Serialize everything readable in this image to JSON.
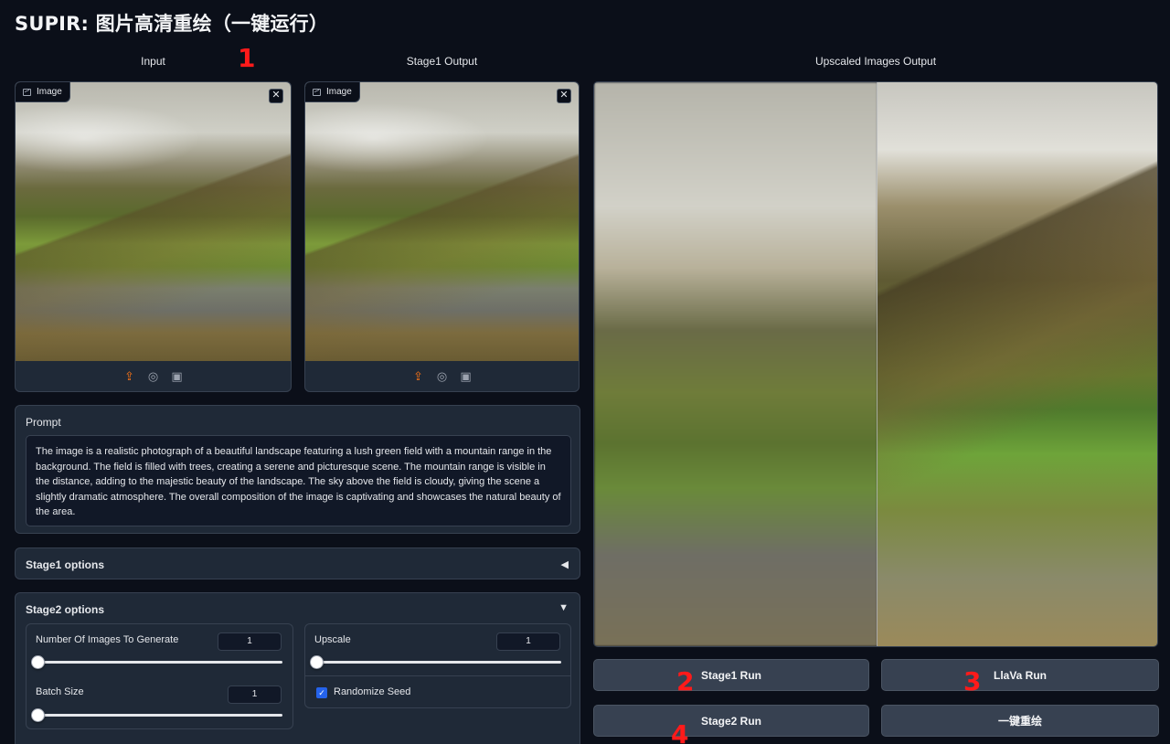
{
  "app": {
    "title": "SUPIR: 图片高清重绘（一键运行）"
  },
  "columns": {
    "input_label": "Input",
    "stage1_label": "Stage1 Output",
    "upscaled_label": "Upscaled Images Output"
  },
  "markers": [
    "1",
    "2",
    "3",
    "4"
  ],
  "image_panels": {
    "badge": "Image",
    "close": "✕",
    "tools": [
      "upload-icon",
      "webcam-icon",
      "clipboard-icon"
    ]
  },
  "prompt": {
    "label": "Prompt",
    "value": "The image is a realistic photograph of a beautiful landscape featuring a lush green field with a mountain range in the background. The field is filled with trees, creating a serene and picturesque scene. The mountain range is visible in the distance, adding to the majestic beauty of the landscape. The sky above the field is cloudy, giving the scene a slightly dramatic atmosphere. The overall composition of the image is captivating and showcases the natural beauty of the area."
  },
  "stage1_options": {
    "label": "Stage1 options",
    "arrow": "◀"
  },
  "stage2_options": {
    "label": "Stage2 options",
    "arrow": "▼",
    "num_images": {
      "label": "Number Of Images To Generate",
      "value": "1",
      "fraction": 0
    },
    "upscale": {
      "label": "Upscale",
      "value": "1",
      "fraction": 0
    },
    "batch_size": {
      "label": "Batch Size",
      "value": "1",
      "fraction": 0
    },
    "randomize_seed": {
      "label": "Randomize Seed",
      "checked": true
    }
  },
  "buttons": {
    "stage1_run": "Stage1 Run",
    "llava_run": "LlaVa Run",
    "stage2_run": "Stage2 Run",
    "one_click": "一键重绘"
  },
  "colors": {
    "accent": "#2563eb",
    "upload": "#f97316",
    "marker": "#ff1a1a"
  }
}
